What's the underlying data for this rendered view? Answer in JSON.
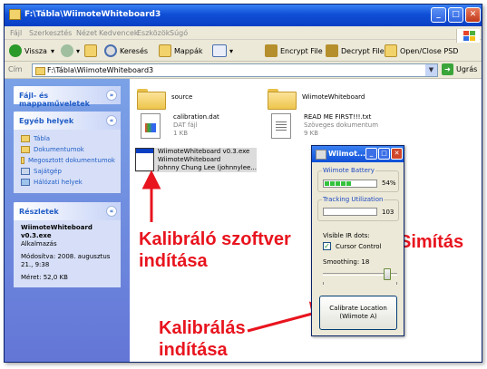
{
  "window": {
    "title": "F:\\Tábla\\WiimoteWhiteboard3"
  },
  "menu": [
    "Fájl",
    "Szerkesztés",
    "Nézet",
    "Kedvencek",
    "Eszközök",
    "Súgó"
  ],
  "toolbar": {
    "back": "Vissza",
    "search": "Keresés",
    "folders": "Mappák",
    "encrypt": "Encrypt File",
    "decrypt": "Decrypt File",
    "psd": "Open/Close PSD"
  },
  "address": {
    "label": "Cím",
    "value": "F:\\Tábla\\WiimoteWhiteboard3",
    "go": "Ugrás"
  },
  "sidebar": {
    "tasks_title": "Fájl- és mappaműveletek",
    "other_title": "Egyéb helyek",
    "other_links": [
      "Tábla",
      "Dokumentumok",
      "Megosztott dokumentumok",
      "Sajátgép",
      "Hálózati helyek"
    ],
    "details_title": "Részletek",
    "details": {
      "name": "WiimoteWhiteboard v0.3.exe",
      "type": "Alkalmazás",
      "modified_label": "Módosítva:",
      "modified": "2008. augusztus 21., 9:38",
      "size": "Méret: 52,0 KB"
    }
  },
  "files": [
    {
      "name": "source"
    },
    {
      "name": "WiimoteWhiteboard"
    },
    {
      "name": "calibration.dat",
      "type": "DAT fájl",
      "size": "1 KB"
    },
    {
      "name": "READ ME FIRST!!!.txt",
      "type": "Szöveges dokumentum",
      "size": "9 KB"
    },
    {
      "name": "WiimoteWhiteboard v0.3.exe",
      "desc": "WiimoteWhiteboard",
      "author": "Johnny Chung Lee (johnnylee..."
    }
  ],
  "wiimote": {
    "title": "Wiimot...",
    "battery_label": "Wiimote Battery",
    "battery_pct": "54%",
    "battery_value": 0.54,
    "tracking_label": "Tracking Utilization",
    "tracking_value": "103",
    "ir_label": "Visible IR dots:",
    "cursor_label": "Cursor Control",
    "cursor_checked": true,
    "smoothing_label": "Smoothing: 18",
    "smoothing_value": 18,
    "calibrate_line1": "Calibrate Location",
    "calibrate_line2": "(Wiimote A)"
  },
  "annotations": {
    "software_1": "Kalibráló szoftver",
    "software_2": "indítása",
    "calib_1": "Kalibrálás",
    "calib_2": "indítása",
    "smooth": "Simítás"
  },
  "colors": {
    "annotation": "#e8141e",
    "xp_blue": "#0f4fd6"
  }
}
